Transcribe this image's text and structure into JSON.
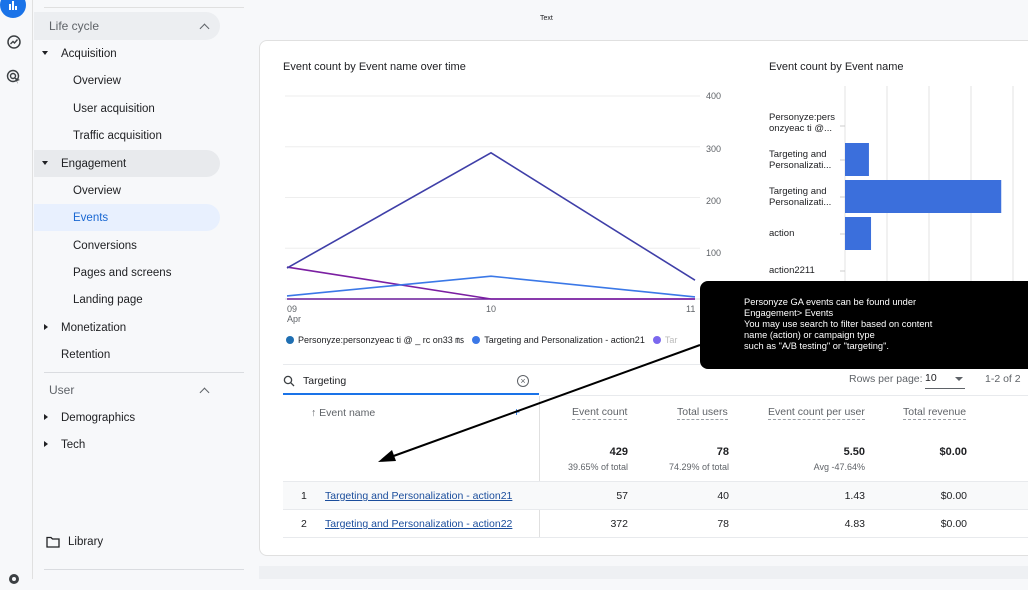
{
  "top_text": "Text",
  "rail": {
    "icons": [
      "reports-icon",
      "explore-icon",
      "advertising-icon",
      "settings-icon"
    ]
  },
  "sidebar": {
    "sections": [
      {
        "label": "Life cycle"
      },
      {
        "label": "User"
      }
    ],
    "items": [
      {
        "label": "Acquisition"
      },
      {
        "label": "Overview"
      },
      {
        "label": "User acquisition"
      },
      {
        "label": "Traffic acquisition"
      },
      {
        "label": "Engagement"
      },
      {
        "label": "Overview"
      },
      {
        "label": "Events"
      },
      {
        "label": "Conversions"
      },
      {
        "label": "Pages and screens"
      },
      {
        "label": "Landing page"
      },
      {
        "label": "Monetization"
      },
      {
        "label": "Retention"
      },
      {
        "label": "Demographics"
      },
      {
        "label": "Tech"
      }
    ],
    "library": "Library"
  },
  "line_chart": {
    "title": "Event count by Event name over time",
    "y_ticks": [
      "400",
      "300",
      "200",
      "100"
    ],
    "x_ticks": [
      {
        "day": "09",
        "month": "Apr"
      },
      {
        "day": "10",
        "month": ""
      },
      {
        "day": "11",
        "month": ""
      }
    ],
    "legend": [
      {
        "label": "Personyze:personzyeac ti @ _ rc on33 ㎳",
        "color": "#1f6fb2"
      },
      {
        "label": "Targeting and Personalization - action21",
        "color": "#3b78e7"
      },
      {
        "label": "Tar",
        "color": "#7b68ee"
      }
    ]
  },
  "bar_chart": {
    "title": "Event count by Event name",
    "labels": [
      [
        "Personyze:pers",
        "onzyeac ti @..."
      ],
      [
        "Targeting and",
        "Personalizati..."
      ],
      [
        "Targeting and",
        "Personalizati..."
      ],
      [
        "action"
      ],
      [
        "action2211"
      ]
    ]
  },
  "chart_data": [
    {
      "type": "line",
      "title": "Event count by Event name over time",
      "x": [
        "09 Apr",
        "10 Apr",
        "11 Apr"
      ],
      "ylim": [
        0,
        400
      ],
      "y_ticks": [
        100,
        200,
        300,
        400
      ],
      "series": [
        {
          "name": "Targeting and Personalization - action22",
          "color": "#3f3fa8",
          "values": [
            61,
            288,
            37
          ]
        },
        {
          "name": "Targeting and Personalization - action21",
          "color": "#3b78e7",
          "values": [
            6,
            45,
            4
          ]
        },
        {
          "name": "Personyze:personzyeac ti @ _ rc on33",
          "color": "#7b1fa2",
          "values": [
            63,
            0,
            0
          ]
        },
        {
          "name": "action2211",
          "color": "#6a1b9a",
          "values": [
            0,
            0,
            0
          ]
        }
      ],
      "legend_position": "bottom"
    },
    {
      "type": "bar",
      "orientation": "horizontal",
      "title": "Event count by Event name",
      "categories": [
        "Personyze:personzyeac ti @...",
        "Targeting and Personalizati... (action21)",
        "Targeting and Personalizati... (action22)",
        "action",
        "action2211"
      ],
      "values": [
        0,
        57,
        372,
        62,
        0
      ],
      "color": "#3b6fdc",
      "xlim": [
        0,
        400
      ],
      "grid": true
    }
  ],
  "tooltip": {
    "lines": [
      "Personyze GA events can be found under",
      "Engagement> Events",
      "You may use search to filter based on content",
      "name (action) or campaign type",
      "such as \"A/B testing\" or \"targeting\"."
    ]
  },
  "table": {
    "search_value": "Targeting",
    "rows_per_page_label": "Rows per page:",
    "rows_per_page_value": "10",
    "pagination": "1-2 of 2",
    "columns": [
      "Event name",
      "Event count",
      "Total users",
      "Event count per user",
      "Total revenue"
    ],
    "totals": {
      "event_count": "429",
      "event_count_sub": "39.65% of total",
      "total_users": "78",
      "total_users_sub": "74.29% of total",
      "per_user": "5.50",
      "per_user_sub": "Avg -47.64%",
      "revenue": "$0.00"
    },
    "rows": [
      {
        "index": "1",
        "name": "Targeting and Personalization - action21",
        "event_count": "57",
        "total_users": "40",
        "per_user": "1.43",
        "revenue": "$0.00"
      },
      {
        "index": "2",
        "name": "Targeting and Personalization - action22",
        "event_count": "372",
        "total_users": "78",
        "per_user": "4.83",
        "revenue": "$0.00"
      }
    ]
  }
}
